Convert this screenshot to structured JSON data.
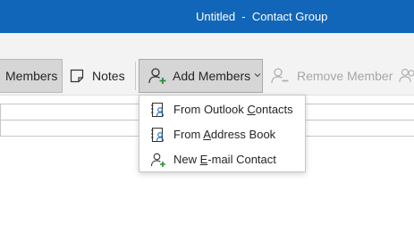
{
  "window": {
    "title": "Untitled  -  Contact Group"
  },
  "ribbon": {
    "members_label": "Members",
    "notes_label": "Notes",
    "add_members_label": "Add Members",
    "remove_member_label": "Remove Member"
  },
  "icons": {
    "notes": "note-icon",
    "add_members": "person-add-icon",
    "remove_member": "person-remove-icon",
    "more": "people-icon",
    "outlook_contacts": "contact-card-icon",
    "address_book": "address-book-icon",
    "new_email_contact": "person-add-icon"
  },
  "menu": {
    "items": [
      {
        "pre": "From Outlook ",
        "accel": "C",
        "post": "ontacts"
      },
      {
        "pre": "From ",
        "accel": "A",
        "post": "ddress Book"
      },
      {
        "pre": "New ",
        "accel": "E",
        "post": "-mail Contact"
      }
    ]
  },
  "colors": {
    "titlebar": "#1266b9",
    "ribbon_bg": "#f3f3f3",
    "pressed_bg": "#d6d6d6",
    "accent_green": "#2e8b3a",
    "disabled_text": "#a6a6a6"
  }
}
